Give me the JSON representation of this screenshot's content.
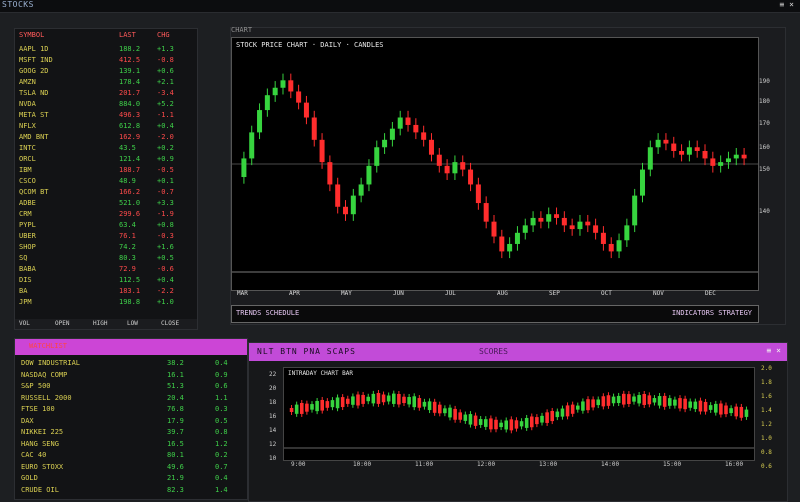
{
  "window": {
    "title": "STOCKS",
    "controls": "≡ ×"
  },
  "watchlist": {
    "headers": [
      "SYMBOL",
      "LAST",
      "CHG"
    ],
    "rows": [
      {
        "sym": "AAPL 1D",
        "a": "188.2",
        "b": "+1.3",
        "dir": "up"
      },
      {
        "sym": "MSFT IND",
        "a": "412.5",
        "b": "-0.8",
        "dir": "dn"
      },
      {
        "sym": "GOOG 2D",
        "a": "139.1",
        "b": "+0.6",
        "dir": "up"
      },
      {
        "sym": "AMZN",
        "a": "178.4",
        "b": "+2.1",
        "dir": "up"
      },
      {
        "sym": "TSLA ND",
        "a": "201.7",
        "b": "-3.4",
        "dir": "dn"
      },
      {
        "sym": "NVDA",
        "a": "884.0",
        "b": "+5.2",
        "dir": "up"
      },
      {
        "sym": "META ST",
        "a": "496.3",
        "b": "-1.1",
        "dir": "dn"
      },
      {
        "sym": "NFLX",
        "a": "612.8",
        "b": "+0.4",
        "dir": "up"
      },
      {
        "sym": "AMD BNT",
        "a": "162.9",
        "b": "-2.0",
        "dir": "dn"
      },
      {
        "sym": "INTC",
        "a": "43.5",
        "b": "+0.2",
        "dir": "up"
      },
      {
        "sym": "ORCL",
        "a": "121.4",
        "b": "+0.9",
        "dir": "up"
      },
      {
        "sym": "IBM",
        "a": "188.7",
        "b": "-0.5",
        "dir": "dn"
      },
      {
        "sym": "CSCO",
        "a": "48.9",
        "b": "+0.1",
        "dir": "up"
      },
      {
        "sym": "QCOM BT",
        "a": "166.2",
        "b": "-0.7",
        "dir": "dn"
      },
      {
        "sym": "ADBE",
        "a": "521.0",
        "b": "+3.3",
        "dir": "up"
      },
      {
        "sym": "CRM",
        "a": "299.6",
        "b": "-1.9",
        "dir": "dn"
      },
      {
        "sym": "PYPL",
        "a": "63.4",
        "b": "+0.8",
        "dir": "up"
      },
      {
        "sym": "UBER",
        "a": "76.1",
        "b": "-0.3",
        "dir": "dn"
      },
      {
        "sym": "SHOP",
        "a": "74.2",
        "b": "+1.6",
        "dir": "up"
      },
      {
        "sym": "SQ",
        "a": "80.3",
        "b": "+0.5",
        "dir": "up"
      },
      {
        "sym": "BABA",
        "a": "72.9",
        "b": "-0.6",
        "dir": "dn"
      },
      {
        "sym": "DIS",
        "a": "112.5",
        "b": "+0.4",
        "dir": "up"
      },
      {
        "sym": "BA",
        "a": "183.1",
        "b": "-2.2",
        "dir": "dn"
      },
      {
        "sym": "JPM",
        "a": "198.8",
        "b": "+1.0",
        "dir": "up"
      }
    ],
    "footer": [
      "VOL",
      "OPEN",
      "HIGH",
      "LOW",
      "CLOSE"
    ]
  },
  "main_chart": {
    "caption": "CHART",
    "title": "STOCK PRICE CHART · DAILY · CANDLES",
    "y_labels": [
      "190",
      "180",
      "170",
      "160",
      "150",
      "140"
    ],
    "x_labels": [
      "MAR",
      "APR",
      "MAY",
      "JUN",
      "JUL",
      "AUG",
      "SEP",
      "OCT",
      "NOV",
      "DEC"
    ],
    "strip_left": "TRENDS SCHEDULE",
    "strip_right": "INDICATORS STRATEGY",
    "up_color": "#37d43f",
    "down_color": "#ff2d2d"
  },
  "chart_data": {
    "type": "candlestick",
    "series": [
      {
        "candles": [
          [
            160,
            165
          ],
          [
            165,
            172
          ],
          [
            172,
            178
          ],
          [
            178,
            182
          ],
          [
            182,
            184
          ],
          [
            184,
            186
          ],
          [
            186,
            183
          ],
          [
            183,
            180
          ],
          [
            180,
            176
          ],
          [
            176,
            170
          ],
          [
            170,
            164
          ],
          [
            164,
            158
          ],
          [
            158,
            152
          ],
          [
            152,
            150
          ],
          [
            150,
            155
          ],
          [
            155,
            158
          ],
          [
            158,
            163
          ],
          [
            163,
            168
          ],
          [
            168,
            170
          ],
          [
            170,
            173
          ],
          [
            173,
            176
          ],
          [
            176,
            174
          ],
          [
            174,
            172
          ],
          [
            172,
            170
          ],
          [
            170,
            166
          ],
          [
            166,
            163
          ],
          [
            163,
            161
          ],
          [
            161,
            164
          ],
          [
            164,
            162
          ],
          [
            162,
            158
          ],
          [
            158,
            153
          ],
          [
            153,
            148
          ],
          [
            148,
            144
          ],
          [
            144,
            140
          ],
          [
            140,
            142
          ],
          [
            142,
            145
          ],
          [
            145,
            147
          ],
          [
            147,
            149
          ],
          [
            149,
            148
          ],
          [
            148,
            150
          ],
          [
            150,
            149
          ],
          [
            149,
            147
          ],
          [
            147,
            146
          ],
          [
            146,
            148
          ],
          [
            148,
            147
          ],
          [
            147,
            145
          ],
          [
            145,
            142
          ],
          [
            142,
            140
          ],
          [
            140,
            143
          ],
          [
            143,
            147
          ],
          [
            147,
            155
          ],
          [
            155,
            162
          ],
          [
            162,
            168
          ],
          [
            168,
            170
          ],
          [
            170,
            169
          ],
          [
            169,
            167
          ],
          [
            167,
            166
          ],
          [
            166,
            168
          ],
          [
            168,
            167
          ],
          [
            167,
            165
          ],
          [
            165,
            163
          ],
          [
            163,
            164
          ],
          [
            164,
            165
          ],
          [
            165,
            166
          ],
          [
            166,
            165
          ]
        ]
      }
    ],
    "ylim": [
      135,
      192
    ],
    "grid": true
  },
  "bottom_list": {
    "bar_label": "WATCHLIST",
    "rows": [
      {
        "s": "DOW INDUSTRIAL",
        "v1": "38.2",
        "v2": "0.4"
      },
      {
        "s": "NASDAQ COMP",
        "v1": "16.1",
        "v2": "0.9"
      },
      {
        "s": "S&P 500",
        "v1": "51.3",
        "v2": "0.6"
      },
      {
        "s": "RUSSELL 2000",
        "v1": "20.4",
        "v2": "1.1"
      },
      {
        "s": "FTSE 100",
        "v1": "76.8",
        "v2": "0.3"
      },
      {
        "s": "DAX",
        "v1": "17.9",
        "v2": "0.5"
      },
      {
        "s": "NIKKEI 225",
        "v1": "39.7",
        "v2": "0.8"
      },
      {
        "s": "HANG SENG",
        "v1": "16.5",
        "v2": "1.2"
      },
      {
        "s": "CAC 40",
        "v1": "80.1",
        "v2": "0.2"
      },
      {
        "s": "EURO STOXX",
        "v1": "49.6",
        "v2": "0.7"
      },
      {
        "s": "GOLD",
        "v1": "21.9",
        "v2": "0.4"
      },
      {
        "s": "CRUDE OIL",
        "v1": "82.3",
        "v2": "1.4"
      }
    ]
  },
  "bottom_chart": {
    "t1": "NLT BTN  PNA  SCAPS",
    "t2": "SCORES",
    "t3": "≡ ×",
    "title": "INTRADAY CHART BAR",
    "x_labels": [
      "9:00",
      "10:00",
      "11:00",
      "12:00",
      "13:00",
      "14:00",
      "15:00",
      "16:00"
    ],
    "y_right": [
      "2.0",
      "1.8",
      "1.6",
      "1.4",
      "1.2",
      "1.0",
      "0.8",
      "0.6"
    ],
    "y_left": [
      "22",
      "20",
      "18",
      "16",
      "14",
      "12",
      "10"
    ]
  }
}
